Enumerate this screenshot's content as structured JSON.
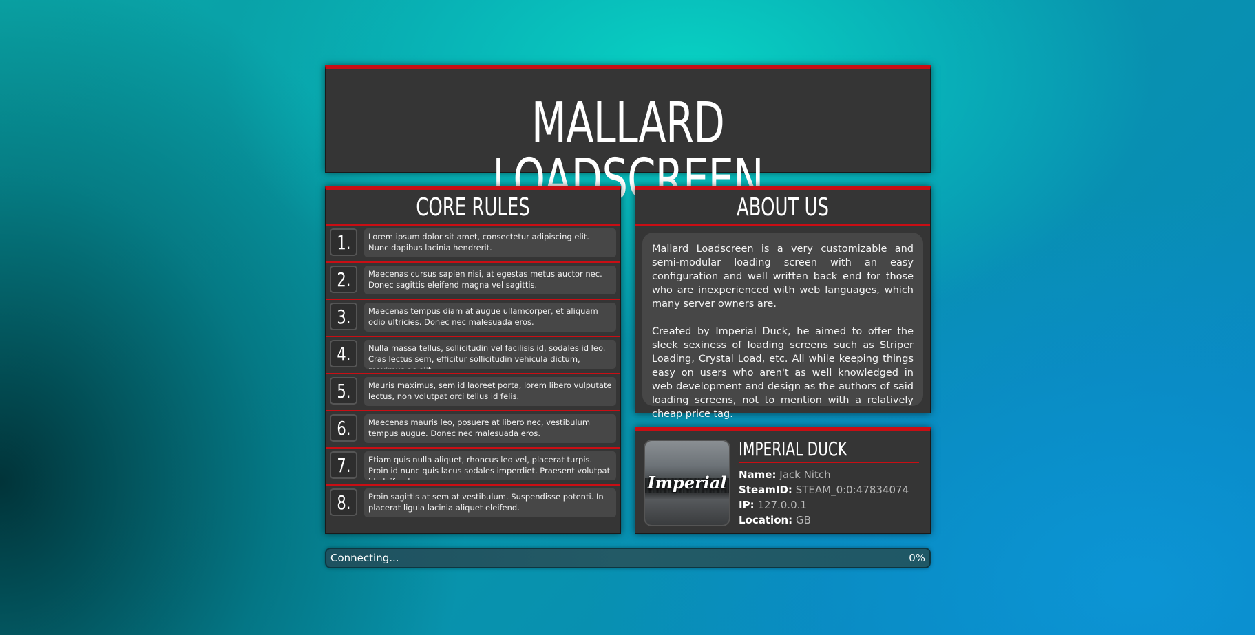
{
  "title": "MALLARD LOADSCREEN",
  "rules": {
    "heading": "CORE RULES",
    "items": [
      {
        "num": "1.",
        "text": "Lorem ipsum dolor sit amet, consectetur adipiscing elit. Nunc dapibus lacinia hendrerit."
      },
      {
        "num": "2.",
        "text": "Maecenas cursus sapien nisi, at egestas metus auctor nec. Donec sagittis eleifend magna vel sagittis."
      },
      {
        "num": "3.",
        "text": "Maecenas tempus diam at augue ullamcorper, et aliquam odio ultricies. Donec nec malesuada eros."
      },
      {
        "num": "4.",
        "text": "Nulla massa tellus, sollicitudin vel facilisis id, sodales id leo. Cras lectus sem, efficitur sollicitudin vehicula dictum, maximus ac elit."
      },
      {
        "num": "5.",
        "text": "Mauris maximus, sem id laoreet porta, lorem libero vulputate lectus, non volutpat orci tellus id felis."
      },
      {
        "num": "6.",
        "text": "Maecenas mauris leo, posuere at libero nec, vestibulum tempus augue. Donec nec malesuada eros."
      },
      {
        "num": "7.",
        "text": "Etiam quis nulla aliquet, rhoncus leo vel, placerat turpis. Proin id nunc quis lacus sodales imperdiet. Praesent volutpat id eleifend."
      },
      {
        "num": "8.",
        "text": "Proin sagittis at sem at vestibulum. Suspendisse potenti. In placerat ligula lacinia aliquet eleifend."
      }
    ]
  },
  "about": {
    "heading": "ABOUT US",
    "paragraph_1": "Mallard Loadscreen is a very customizable and semi-modular loading screen with an easy configuration and well written back end for those who are inexperienced with web languages, which many server owners are.",
    "paragraph_2": "Created by Imperial Duck, he aimed to offer the sleek sexiness of loading screens such as Striper Loading, Crystal Load, etc. All while keeping things easy on users who aren't as well knowledged in web development and design as the authors of said loading screens, not to mention with a relatively cheap price tag."
  },
  "player": {
    "avatar_text": "Imperial",
    "display_name": "IMPERIAL DUCK",
    "name_label": "Name:",
    "name_value": "Jack Nitch",
    "steamid_label": "SteamID:",
    "steamid_value": "STEAM_0:0:47834074",
    "ip_label": "IP:",
    "ip_value": "127.0.0.1",
    "location_label": "Location:",
    "location_value": "GB"
  },
  "progress": {
    "status": "Connecting...",
    "percent_label": "0%",
    "fraction": 0
  },
  "colors": {
    "accent": "#c90e14",
    "panel": "#353535",
    "inner": "#474747"
  }
}
